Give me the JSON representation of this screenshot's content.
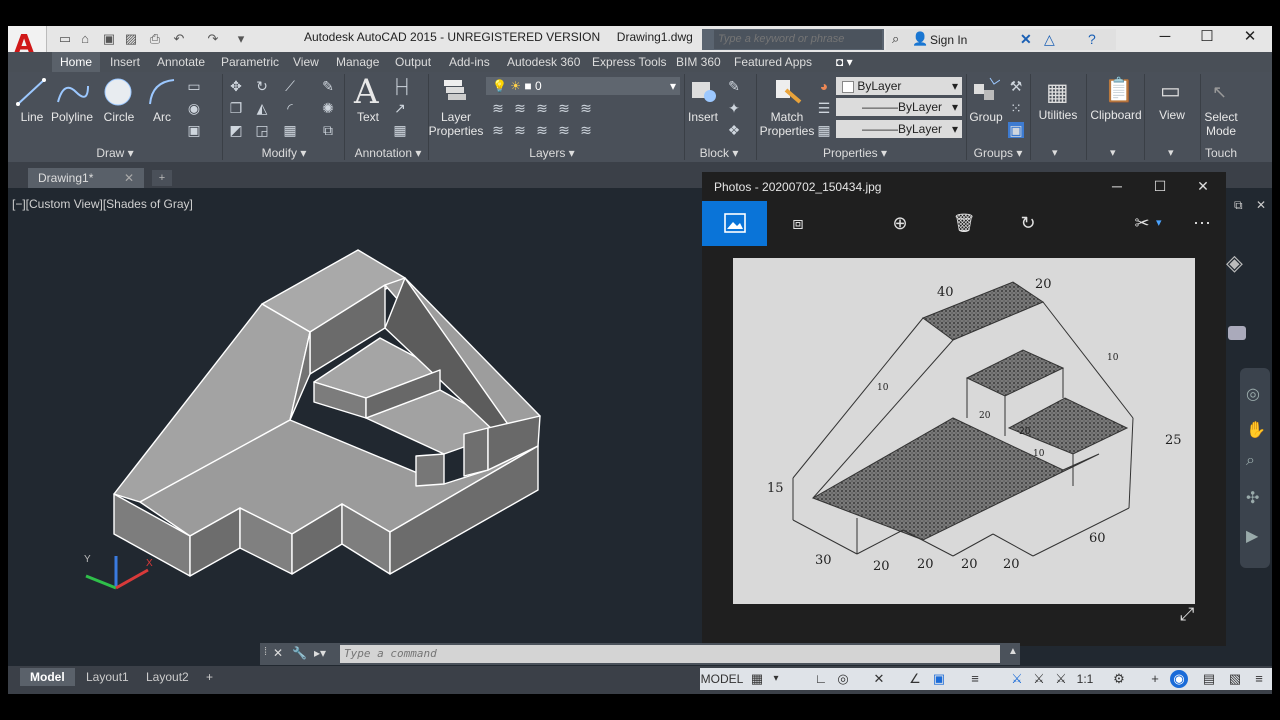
{
  "window": {
    "title": "Autodesk AutoCAD 2015 - UNREGISTERED VERSION",
    "file": "Drawing1.dwg",
    "search_placeholder": "Type a keyword or phrase",
    "sign_in": "Sign In"
  },
  "ribbon_tabs": [
    "Home",
    "Insert",
    "Annotate",
    "Parametric",
    "View",
    "Manage",
    "Output",
    "Add-ins",
    "Autodesk 360",
    "Express Tools",
    "BIM 360",
    "Featured Apps"
  ],
  "draw": {
    "line": "Line",
    "polyline": "Polyline",
    "circle": "Circle",
    "arc": "Arc",
    "title": "Draw"
  },
  "modify": {
    "title": "Modify"
  },
  "annotation": {
    "text": "Text",
    "title": "Annotation"
  },
  "layers": {
    "layer_properties": "Layer\nProperties",
    "layer_value": "0",
    "title": "Layers"
  },
  "block": {
    "insert": "Insert",
    "title": "Block"
  },
  "properties": {
    "match": "Match\nProperties",
    "color": "ByLayer",
    "linetype": "ByLayer",
    "lineweight": "ByLayer",
    "title": "Properties"
  },
  "groups": {
    "group": "Group",
    "title": "Groups"
  },
  "utilities": "Utilities",
  "clipboard": "Clipboard",
  "view": "View",
  "touch": {
    "select_mode": "Select\nMode",
    "title": "Touch"
  },
  "file_tab": "Drawing1*",
  "viewport_label": "[−][Custom View][Shades of Gray]",
  "command_placeholder": "Type a command",
  "layout_tabs": [
    "Model",
    "Layout1",
    "Layout2"
  ],
  "status": {
    "model": "MODEL",
    "scale": "1:1"
  },
  "photos": {
    "title": "Photos - 20200702_150434.jpg",
    "dims": {
      "d40": "40",
      "d20a": "20",
      "d10a": "10",
      "d10b": "10",
      "d10c": "10",
      "d20b": "20",
      "d20c": "20",
      "d25": "25",
      "d15": "15",
      "d30": "30",
      "d20d": "20",
      "d20e": "20",
      "d20f": "20",
      "d20g": "20",
      "d60": "60"
    }
  }
}
